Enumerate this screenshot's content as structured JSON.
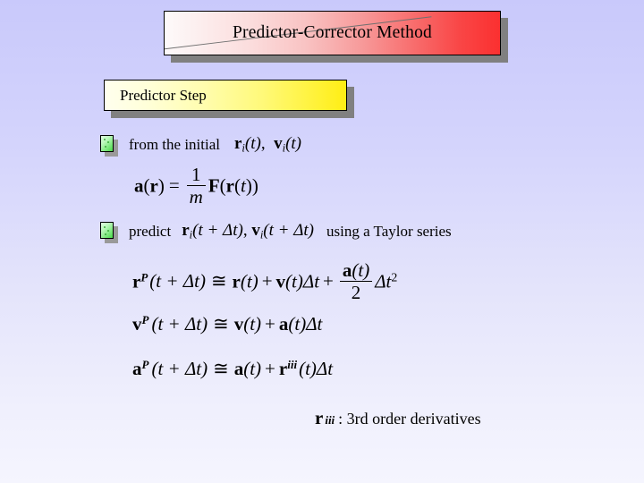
{
  "slide": {
    "title": "Predictor-Corrector Method",
    "subtitle": "Predictor Step",
    "background_top_color": "#c9c9fb",
    "background_bottom_color": "#f5f5fe",
    "title_gradient_start": "#fdfafa",
    "title_gradient_end": "#fb3030",
    "subtitle_gradient_start": "#ffffee",
    "subtitle_gradient_end": "#ffee14",
    "bullet_color": "#49d949",
    "shadow_color": "#808080"
  },
  "bullets": [
    {
      "name": "from-the-initial",
      "text": "from the initial",
      "math": "r_i(t), v_i(t)",
      "math_parts": {
        "sym1": "r",
        "sub1": "i",
        "arg1": "(t)",
        "comma": ",",
        "sym2": "v",
        "sub2": "i",
        "arg2": "(t)"
      }
    },
    {
      "name": "predict-taylor",
      "text": "predict",
      "math": "r_i(t + Δt), v_i(t + Δt)",
      "trailing_text": "using a Taylor series",
      "math_parts": {
        "sym1": "r",
        "sub1": "i",
        "arg1": "(t + Δt)",
        "comma": ",",
        "sym2": "v",
        "sub2": "i",
        "arg2": "(t + Δt)"
      }
    }
  ],
  "equations": [
    {
      "name": "acceleration-definition",
      "latex": "a(r) = (1/m) F(r(t))",
      "lhs_sym": "a",
      "lhs_arg_open": "(",
      "lhs_arg_sym": "r",
      "lhs_arg_close": ")",
      "relation": "=",
      "frac_num": "1",
      "frac_den": "m",
      "rhs_sym": "F",
      "rhs_arg": "(r(t))"
    },
    {
      "name": "predicted-position",
      "latex": "r^P(t + Δt) ≅ r(t) + v(t)Δt + (a(t)/2)Δt^2",
      "lhs_sym": "r",
      "lhs_sup": "P",
      "lhs_arg": "(t + Δt)",
      "relation": "≅",
      "term1_sym": "r",
      "term1_arg": "(t)",
      "plus1": "+",
      "term2_sym": "v",
      "term2_arg": "(t)",
      "term2_delta": "Δt",
      "plus2": "+",
      "frac_num_sym": "a",
      "frac_num_arg": "(t)",
      "frac_den": "2",
      "tail_delta": "Δt",
      "tail_exp": "2"
    },
    {
      "name": "predicted-velocity",
      "latex": "v^P(t + Δt) ≅ v(t) + a(t)Δt",
      "lhs_sym": "v",
      "lhs_sup": "P",
      "lhs_arg": "(t + Δt)",
      "relation": "≅",
      "term1_sym": "v",
      "term1_arg": "(t)",
      "plus1": "+",
      "term2_sym": "a",
      "term2_arg": "(t)",
      "term2_delta": "Δt"
    },
    {
      "name": "predicted-acceleration",
      "latex": "a^P(t + Δt) ≅ a(t) + r^iii(t)Δt",
      "lhs_sym": "a",
      "lhs_sup": "P",
      "lhs_arg": "(t + Δt)",
      "relation": "≅",
      "term1_sym": "a",
      "term1_arg": "(t)",
      "plus1": "+",
      "term2_sym": "r",
      "term2_sup": "iii",
      "term2_arg": "(t)",
      "term2_delta": "Δt"
    }
  ],
  "footnote": {
    "symbol": "r",
    "superscript": "iii",
    "label": ": 3rd order derivatives"
  }
}
